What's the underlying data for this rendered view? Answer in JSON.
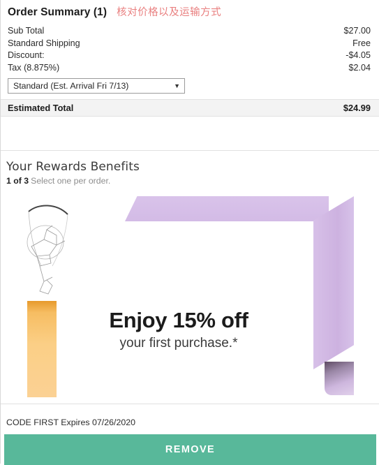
{
  "order_summary": {
    "title": "Order Summary (1)",
    "annotation": "核对价格以及运输方式",
    "annotation_color": "#e98080",
    "lines": [
      {
        "label": "Sub Total",
        "value": "$27.00"
      },
      {
        "label": "Standard Shipping",
        "value": "Free"
      },
      {
        "label": "Discount:",
        "value": "-$4.05"
      },
      {
        "label": "Tax (8.875%)",
        "value": "$2.04"
      }
    ],
    "shipping_select": {
      "selected": "Standard (Est. Arrival Fri 7/13)",
      "caret_icon": "chevron-down-icon"
    },
    "estimated_total": {
      "label": "Estimated Total",
      "value": "$24.99"
    }
  },
  "rewards": {
    "title": "Your Rewards Benefits",
    "count": "1 of 3",
    "hint": "Select one per order."
  },
  "promo": {
    "headline": "Enjoy 15% off",
    "subline": "your first purchase.*"
  },
  "code": {
    "text": "CODE FIRST Expires 07/26/2020"
  },
  "actions": {
    "remove_label": "REMOVE",
    "remove_color": "#58b89a"
  }
}
